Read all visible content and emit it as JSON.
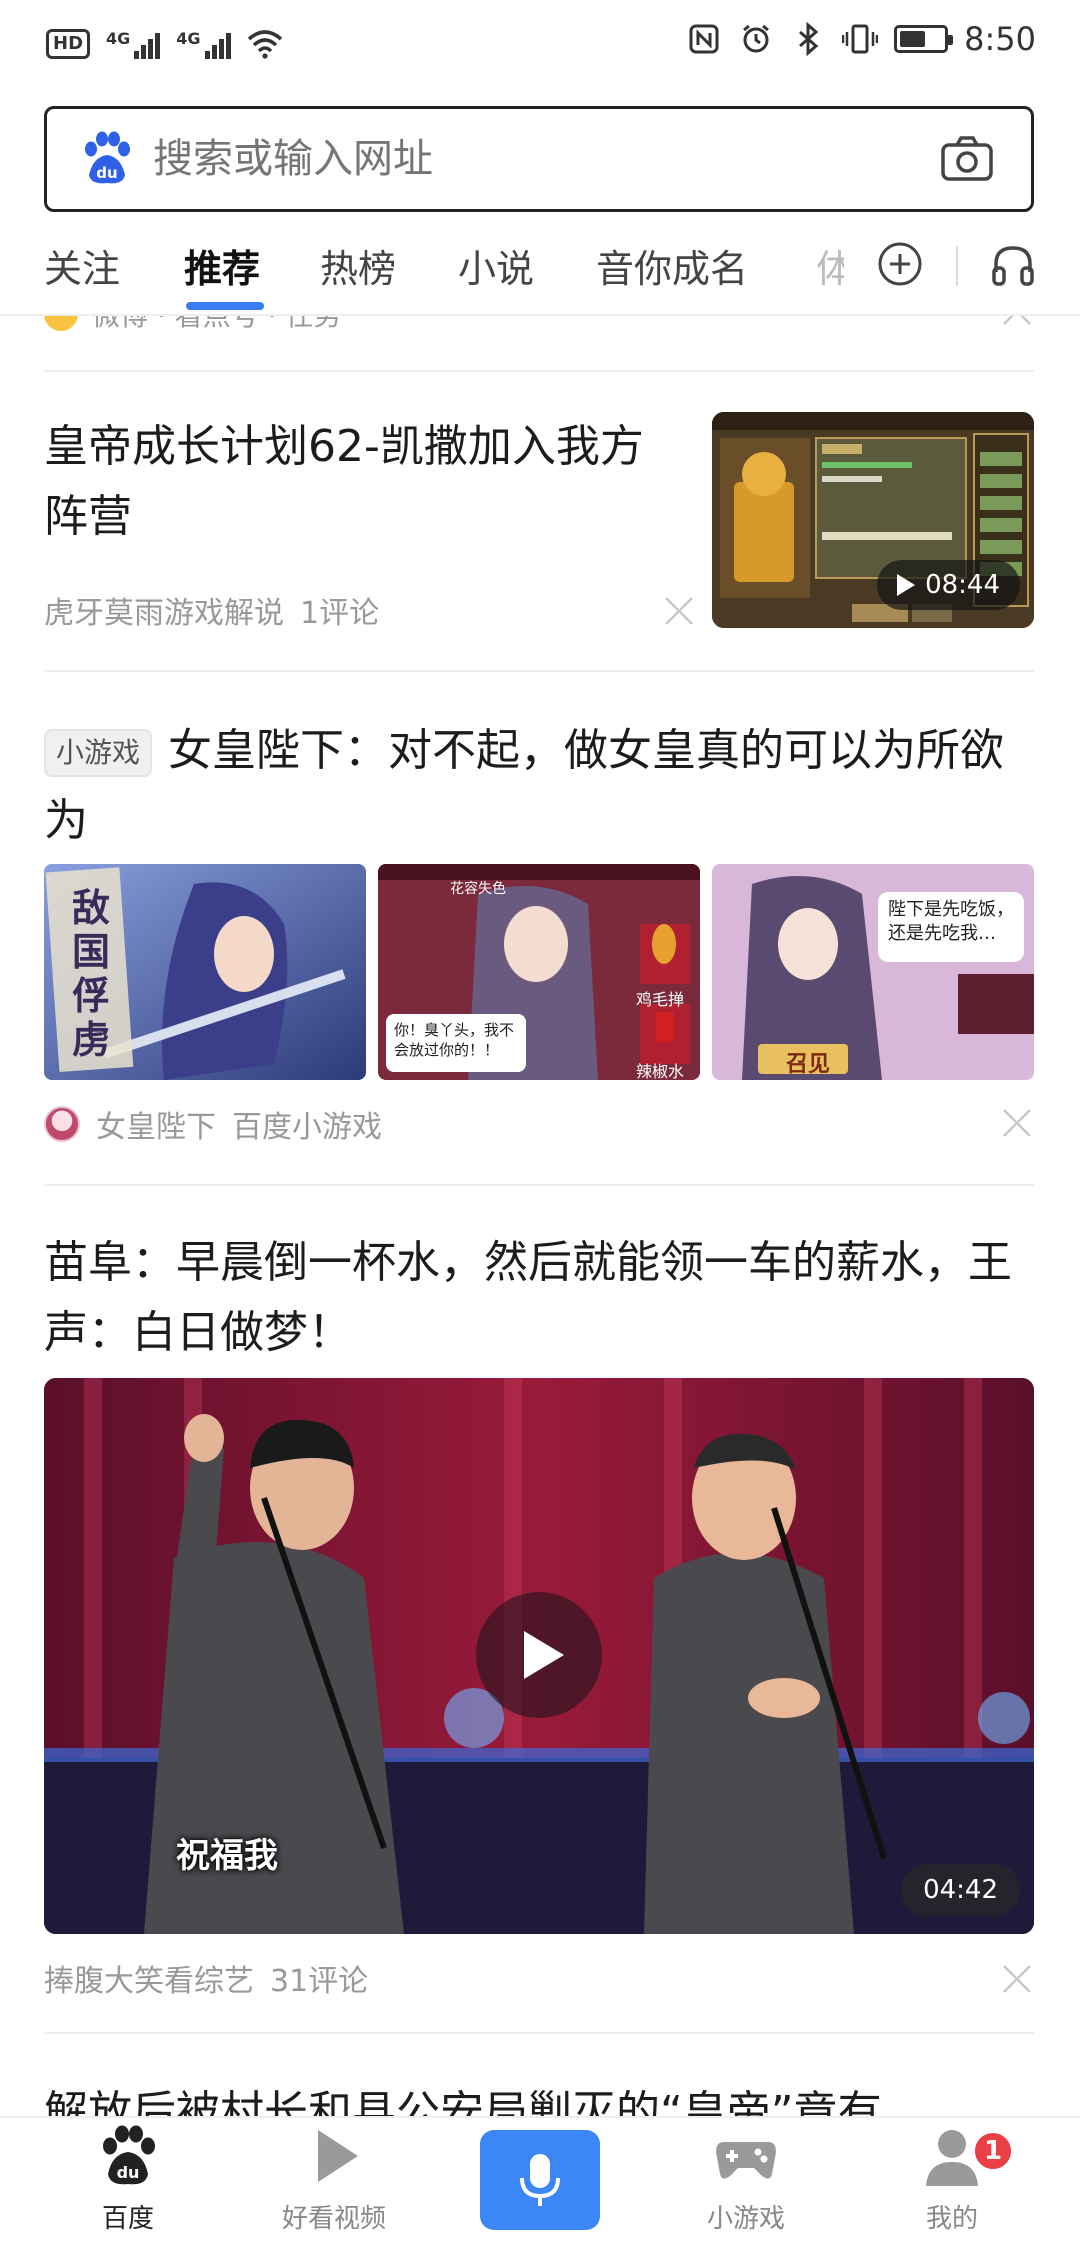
{
  "status_bar": {
    "hd_label": "HD",
    "signal1_tag": "4G",
    "signal2_tag": "4G",
    "time": "8:50",
    "battery_level": 0.6,
    "icons": [
      "nfc-icon",
      "alarm-icon",
      "bluetooth-icon",
      "vibrate-icon",
      "battery-icon"
    ]
  },
  "search": {
    "placeholder": "搜索或输入网址",
    "logo_icon": "baidu-paw-icon",
    "camera_icon": "camera-icon"
  },
  "tabs": {
    "items": [
      "关注",
      "推荐",
      "热榜",
      "小说",
      "音你成名",
      "体"
    ],
    "active_index": 1,
    "add_icon": "plus-circle-icon",
    "audio_icon": "headphones-icon"
  },
  "feed": {
    "partial_meta": "微博 · 看点号 · 任务",
    "card1": {
      "title": "皇帝成长计划62-凯撒加入我方阵营",
      "source": "虎牙莫雨游戏解说",
      "comments": "1评论",
      "duration": "08:44"
    },
    "card2": {
      "tag": "小游戏",
      "title": "女皇陛下：对不起，做女皇真的可以为所欲为",
      "images": [
        {
          "text": "敌国俘虏"
        },
        {
          "text": "你！臭丫头，我不会放过你的！！",
          "label2": "花容失色",
          "label3": "鸡毛掸",
          "label4": "辣椒水"
        },
        {
          "text": "陛下是先吃饭，还是先吃我…",
          "button": "召见"
        }
      ],
      "source": "女皇陛下",
      "platform": "百度小游戏"
    },
    "card3": {
      "title": "苗阜：早晨倒一杯水，然后就能领一车的薪水，王声：白日做梦！",
      "caption": "祝福我",
      "duration": "04:42",
      "source": "捧腹大笑看综艺",
      "comments": "31评论"
    },
    "card4_title_partial": "解放后被村长和县公安局剿灭的“皇帝”竟有"
  },
  "bottom_nav": {
    "items": [
      {
        "label": "百度",
        "icon": "baidu-paw-icon",
        "active": true
      },
      {
        "label": "好看视频",
        "icon": "play-icon",
        "active": false
      },
      {
        "label": "",
        "icon": "microphone-icon",
        "active": false
      },
      {
        "label": "小游戏",
        "icon": "gamepad-icon",
        "active": false
      },
      {
        "label": "我的",
        "icon": "user-icon",
        "active": false,
        "badge": "1"
      }
    ]
  },
  "colors": {
    "accent": "#3d86f5",
    "tab_underline": "#3a7cf4",
    "badge": "#ea3f45",
    "meta_text": "#999999"
  }
}
